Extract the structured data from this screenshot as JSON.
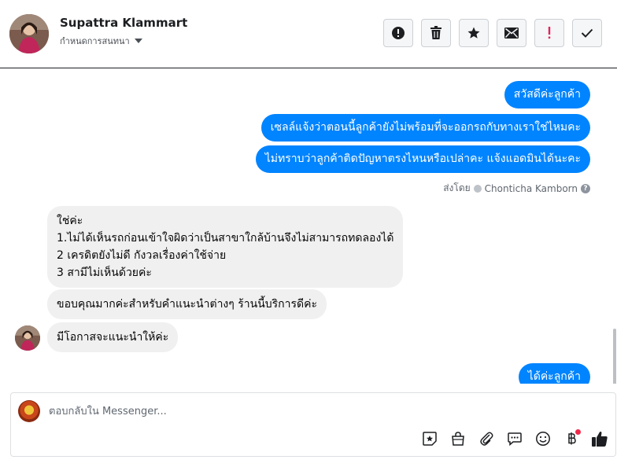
{
  "header": {
    "contact_name": "Supattra Klammart",
    "assign_label": "กำหนดการสนทนา",
    "actions": [
      {
        "name": "report-spam-button",
        "icon": "alert-circle-icon"
      },
      {
        "name": "delete-button",
        "icon": "trash-icon"
      },
      {
        "name": "star-button",
        "icon": "star-icon"
      },
      {
        "name": "mark-unread-button",
        "icon": "envelope-icon"
      },
      {
        "name": "follow-up-button",
        "icon": "exclamation-icon"
      },
      {
        "name": "mark-done-button",
        "icon": "check-icon"
      }
    ]
  },
  "messages": {
    "outgoing": [
      "สวัสดีค่ะลูกค้า",
      "เซลล์แจ้งว่าตอนนี้ลูกค้ายังไม่พร้อมที่จะออกรถกับทางเราใช่ไหมคะ",
      "ไม่ทราบว่าลูกค้าติดปัญหาตรงไหนหรือเปล่าคะ แจ้งแอดมินได้นะคะ"
    ],
    "sent_by_label": "ส่งโดย",
    "sent_by_name": "Chonticha Kamborn",
    "incoming_block": [
      "ใช่ค่ะ",
      "1.ไม่ได้เห็นรถก่อนเข้าใจผิดว่าเป็นสาขาใกล้บ้านจึงไม่สามารถทดลองได้",
      "2 เครดิตยังไม่ดี กังวลเรื่องค่าใช้จ่าย",
      "3 สามีไม่เห็นด้วยค่ะ"
    ],
    "incoming_thanks": "ขอบคุณมากค่ะสำหรับคำแนะนำต่างๆ ร้านนี้บริการดีค่ะ",
    "incoming_last": "มีโอกาสจะแนะนำให้ค่ะ",
    "outgoing_last": "ได้ค่ะลูกค้า"
  },
  "reply": {
    "placeholder": "ตอบกลับใน Messenger...",
    "tools": [
      "sticker-icon",
      "shop-bag-icon",
      "attach-icon",
      "saved-reply-icon",
      "emoji-icon",
      "payment-baht-icon",
      "like-icon"
    ]
  },
  "colors": {
    "accent": "#0084ff",
    "incoming_bg": "#f1f0f0",
    "notify_red": "#f02849"
  }
}
